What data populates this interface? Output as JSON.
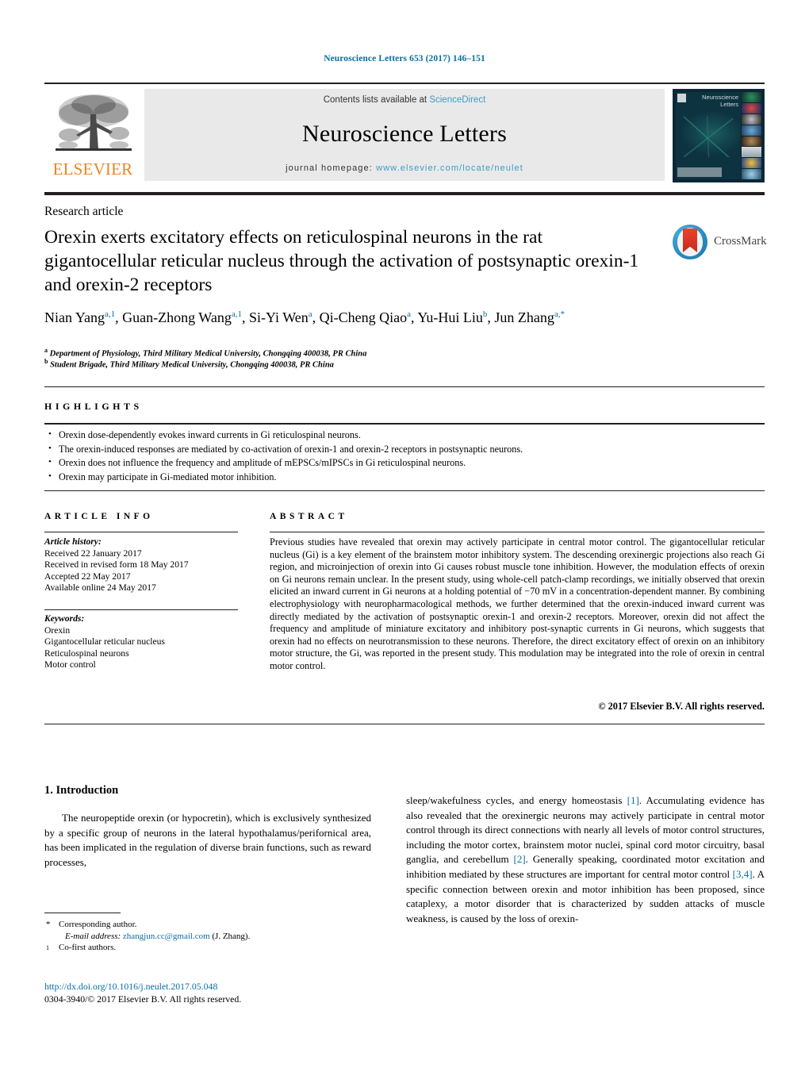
{
  "running_head": "Neuroscience Letters 653 (2017) 146–151",
  "masthead": {
    "contents_prefix": "Contents lists available at ",
    "sciencedirect": "ScienceDirect",
    "journal_name": "Neuroscience Letters",
    "homepage_prefix": "journal homepage: ",
    "homepage_url": "www.elsevier.com/locate/neulet",
    "publisher": "ELSEVIER",
    "cover_title": "Neuroscience Letters",
    "accent_link_color": "#3c9cc8",
    "publisher_color": "#ec8524"
  },
  "article": {
    "type": "Research article",
    "title": "Orexin exerts excitatory effects on reticulospinal neurons in the rat gigantocellular reticular nucleus through the activation of postsynaptic orexin-1 and orexin-2 receptors",
    "crossmark_label": "CrossMark",
    "authors_line1": "Nian Yang",
    "authors": [
      {
        "name": "Nian Yang",
        "sup": "a,1"
      },
      {
        "name": "Guan-Zhong Wang",
        "sup": "a,1"
      },
      {
        "name": "Si-Yi Wen",
        "sup": "a"
      },
      {
        "name": "Qi-Cheng Qiao",
        "sup": "a"
      },
      {
        "name": "Yu-Hui Liu",
        "sup": "b"
      },
      {
        "name": "Jun Zhang",
        "sup": "a,*"
      }
    ],
    "affiliations": [
      {
        "marker": "a",
        "text": "Department of Physiology, Third Military Medical University, Chongqing 400038, PR China"
      },
      {
        "marker": "b",
        "text": "Student Brigade, Third Military Medical University, Chongqing 400038, PR China"
      }
    ]
  },
  "highlights": {
    "heading": "HIGHLIGHTS",
    "items": [
      "Orexin dose-dependently evokes inward currents in Gi reticulospinal neurons.",
      "The orexin-induced responses are mediated by co-activation of orexin-1 and orexin-2 receptors in postsynaptic neurons.",
      "Orexin does not influence the frequency and amplitude of mEPSCs/mIPSCs in Gi reticulospinal neurons.",
      "Orexin may participate in Gi-mediated motor inhibition."
    ]
  },
  "article_info": {
    "heading": "ARTICLE INFO",
    "history_label": "Article history:",
    "history": [
      "Received 22 January 2017",
      "Received in revised form 18 May 2017",
      "Accepted 22 May 2017",
      "Available online 24 May 2017"
    ],
    "keywords_label": "Keywords:",
    "keywords": [
      "Orexin",
      "Gigantocellular reticular nucleus",
      "Reticulospinal neurons",
      "Motor control"
    ]
  },
  "abstract": {
    "heading": "ABSTRACT",
    "text": "Previous studies have revealed that orexin may actively participate in central motor control. The gigantocellular reticular nucleus (Gi) is a key element of the brainstem motor inhibitory system. The descending orexinergic projections also reach Gi region, and microinjection of orexin into Gi causes robust muscle tone inhibition. However, the modulation effects of orexin on Gi neurons remain unclear. In the present study, using whole-cell patch-clamp recordings, we initially observed that orexin elicited an inward current in Gi neurons at a holding potential of −70 mV in a concentration-dependent manner. By combining electrophysiology with neuropharmacological methods, we further determined that the orexin-induced inward current was directly mediated by the activation of postsynaptic orexin-1 and orexin-2 receptors. Moreover, orexin did not affect the frequency and amplitude of miniature excitatory and inhibitory post-synaptic currents in Gi neurons, which suggests that orexin had no effects on neurotransmission to these neurons. Therefore, the direct excitatory effect of orexin on an inhibitory motor structure, the Gi, was reported in the present study. This modulation may be integrated into the role of orexin in central motor control.",
    "copyright": "© 2017 Elsevier B.V. All rights reserved."
  },
  "introduction": {
    "section_number_title": "1.  Introduction",
    "left_paragraph": "The neuropeptide orexin (or hypocretin), which is exclusively synthesized by a specific group of neurons in the lateral hypothalamus/perifornical area, has been implicated in the regulation of diverse brain functions, such as reward processes,",
    "right_part1": "sleep/wakefulness cycles, and energy homeostasis ",
    "right_ref1": "[1]",
    "right_part2": ". Accumulating evidence has also revealed that the orexinergic neurons may actively participate in central motor control through its direct connections with nearly all levels of motor control structures, including the motor cortex, brainstem motor nuclei, spinal cord motor circuitry, basal ganglia, and cerebellum ",
    "right_ref2": "[2]",
    "right_part3": ". Generally speaking, coordinated motor excitation and inhibition mediated by these structures are important for central motor control ",
    "right_ref3": "[3,4]",
    "right_part4": ". A specific connection between orexin and motor inhibition has been proposed, since cataplexy, a motor disorder that is characterized by sudden attacks of muscle weakness, is caused by the loss of orexin-"
  },
  "footer": {
    "corresponding_marker": "*",
    "corresponding_label": "Corresponding author.",
    "email_label": "E-mail address:",
    "email": "zhangjun.cc@gmail.com",
    "email_owner": "(J. Zhang).",
    "cofirst_marker": "1",
    "cofirst_label": "Co-first authors.",
    "doi": "http://dx.doi.org/10.1016/j.neulet.2017.05.048",
    "issn_line": "0304-3940/© 2017 Elsevier B.V. All rights reserved."
  }
}
